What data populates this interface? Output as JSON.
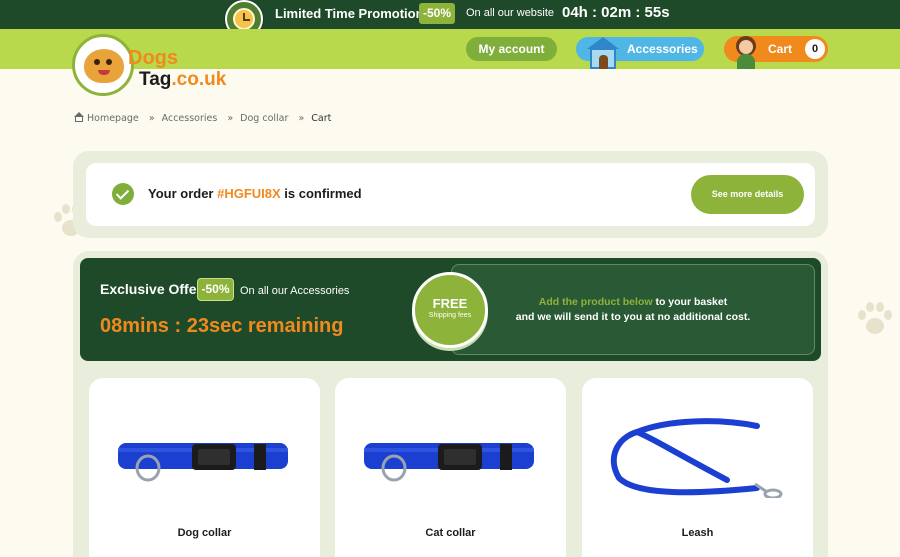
{
  "promo": {
    "label": "Limited Time Promotion:",
    "badge": "-50%",
    "sub": "On all our website",
    "timer": "04h : 02m : 55s",
    "clock_icon": "clock-icon"
  },
  "header": {
    "logo_line1": "Dogs",
    "logo_line2_main": "Tag",
    "logo_line2_suffix": ".co.uk",
    "account_label": "My account",
    "accessories_label": "Accessories",
    "cart_label": "Cart",
    "cart_count": "0"
  },
  "breadcrumb": {
    "items": [
      "Homepage",
      "Accessories",
      "Dog collar",
      "Cart"
    ],
    "separator": "»"
  },
  "confirmation": {
    "prefix": "Your order ",
    "order_number": "#HGFUI8X",
    "suffix": " is confirmed",
    "details_button": "See more details"
  },
  "offer": {
    "title": "Exclusive Offer!",
    "badge": "-50%",
    "sub": "On all our Accessories",
    "timer": "08mins : 23sec remaining",
    "free_title": "FREE",
    "free_sub": "Shipping fees",
    "msg_highlight": "Add the product below",
    "msg_rest1": " to your basket",
    "msg_line2": "and we will send it to you at no additional cost."
  },
  "products": [
    {
      "name": "Dog collar",
      "swatches": [
        "#1f4d8f",
        "#1c1c1c",
        "#c0392b",
        "#8e2c6e",
        "#7a2d8f",
        "#e05a2a"
      ]
    },
    {
      "name": "Cat collar",
      "swatches": [
        "#1f4d8f",
        "#1c1c1c",
        "#c0392b",
        "#8e2c6e",
        "#7a2d8f",
        "#e05a2a"
      ]
    },
    {
      "name": "Leash",
      "swatches": [
        "#1f4d8f",
        "#1c1c1c",
        "#c0392b",
        "#8e2c6e",
        "#7a2d8f",
        "#e05a2a"
      ]
    }
  ],
  "colors": {
    "dark_green": "#1e4a2a",
    "lime": "#b8d94c",
    "green": "#8db33a",
    "orange": "#f08a1d",
    "blue": "#4fb6e6",
    "cream": "#fdfbf0",
    "product_blue": "#1a3fd1"
  }
}
